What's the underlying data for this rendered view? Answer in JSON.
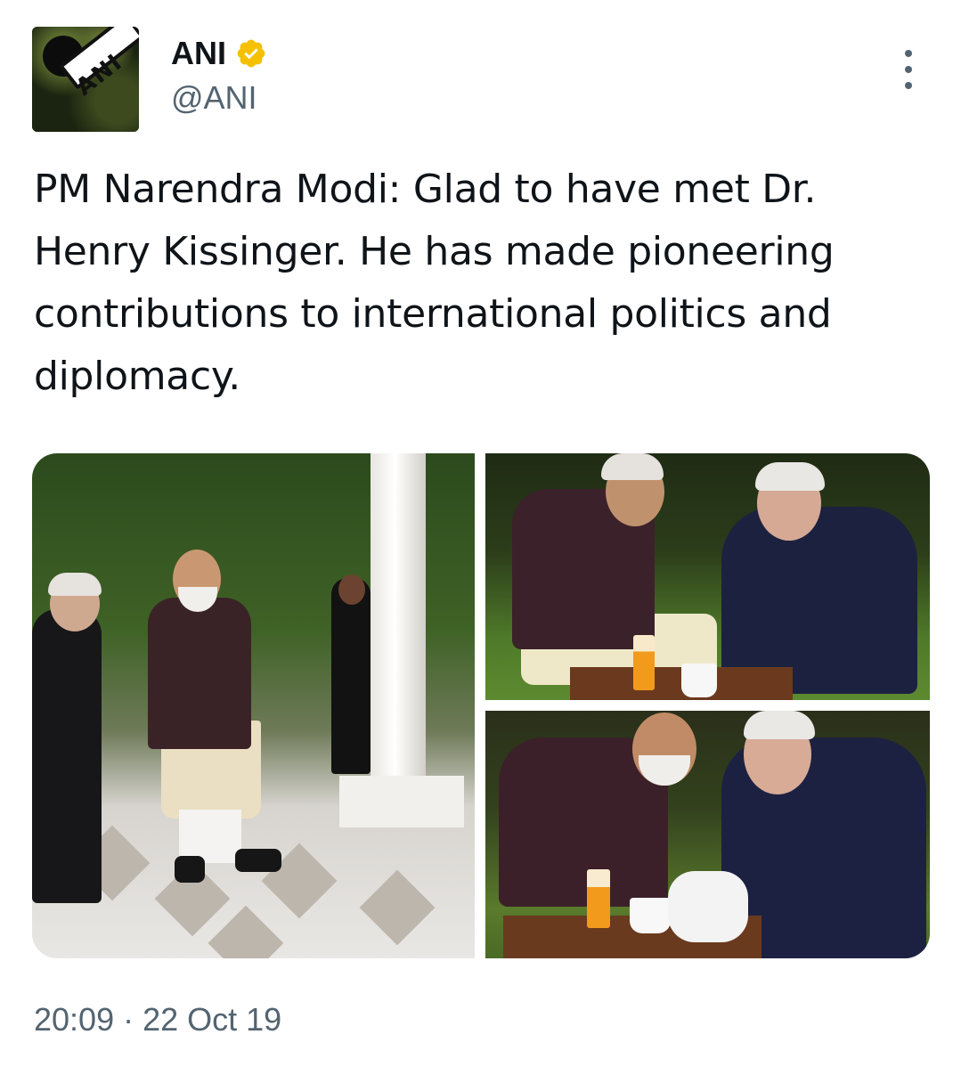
{
  "author": {
    "display_name": "ANI",
    "handle": "@ANI",
    "avatar_logo_text": "ANI",
    "verified": true,
    "verified_color": "#f4c000"
  },
  "more_button": {
    "icon": "more-vertical-icon"
  },
  "tweet": {
    "text": "PM Narendra Modi: Glad to have met Dr. Henry Kissinger. He has made pioneering contributions to international politics and diplomacy."
  },
  "media": {
    "photo_count": 3
  },
  "footer": {
    "time": "20:09",
    "separator": "·",
    "date": "22 Oct 19"
  },
  "colors": {
    "text": "#0f1419",
    "secondary_text": "#536471",
    "background": "#ffffff"
  }
}
